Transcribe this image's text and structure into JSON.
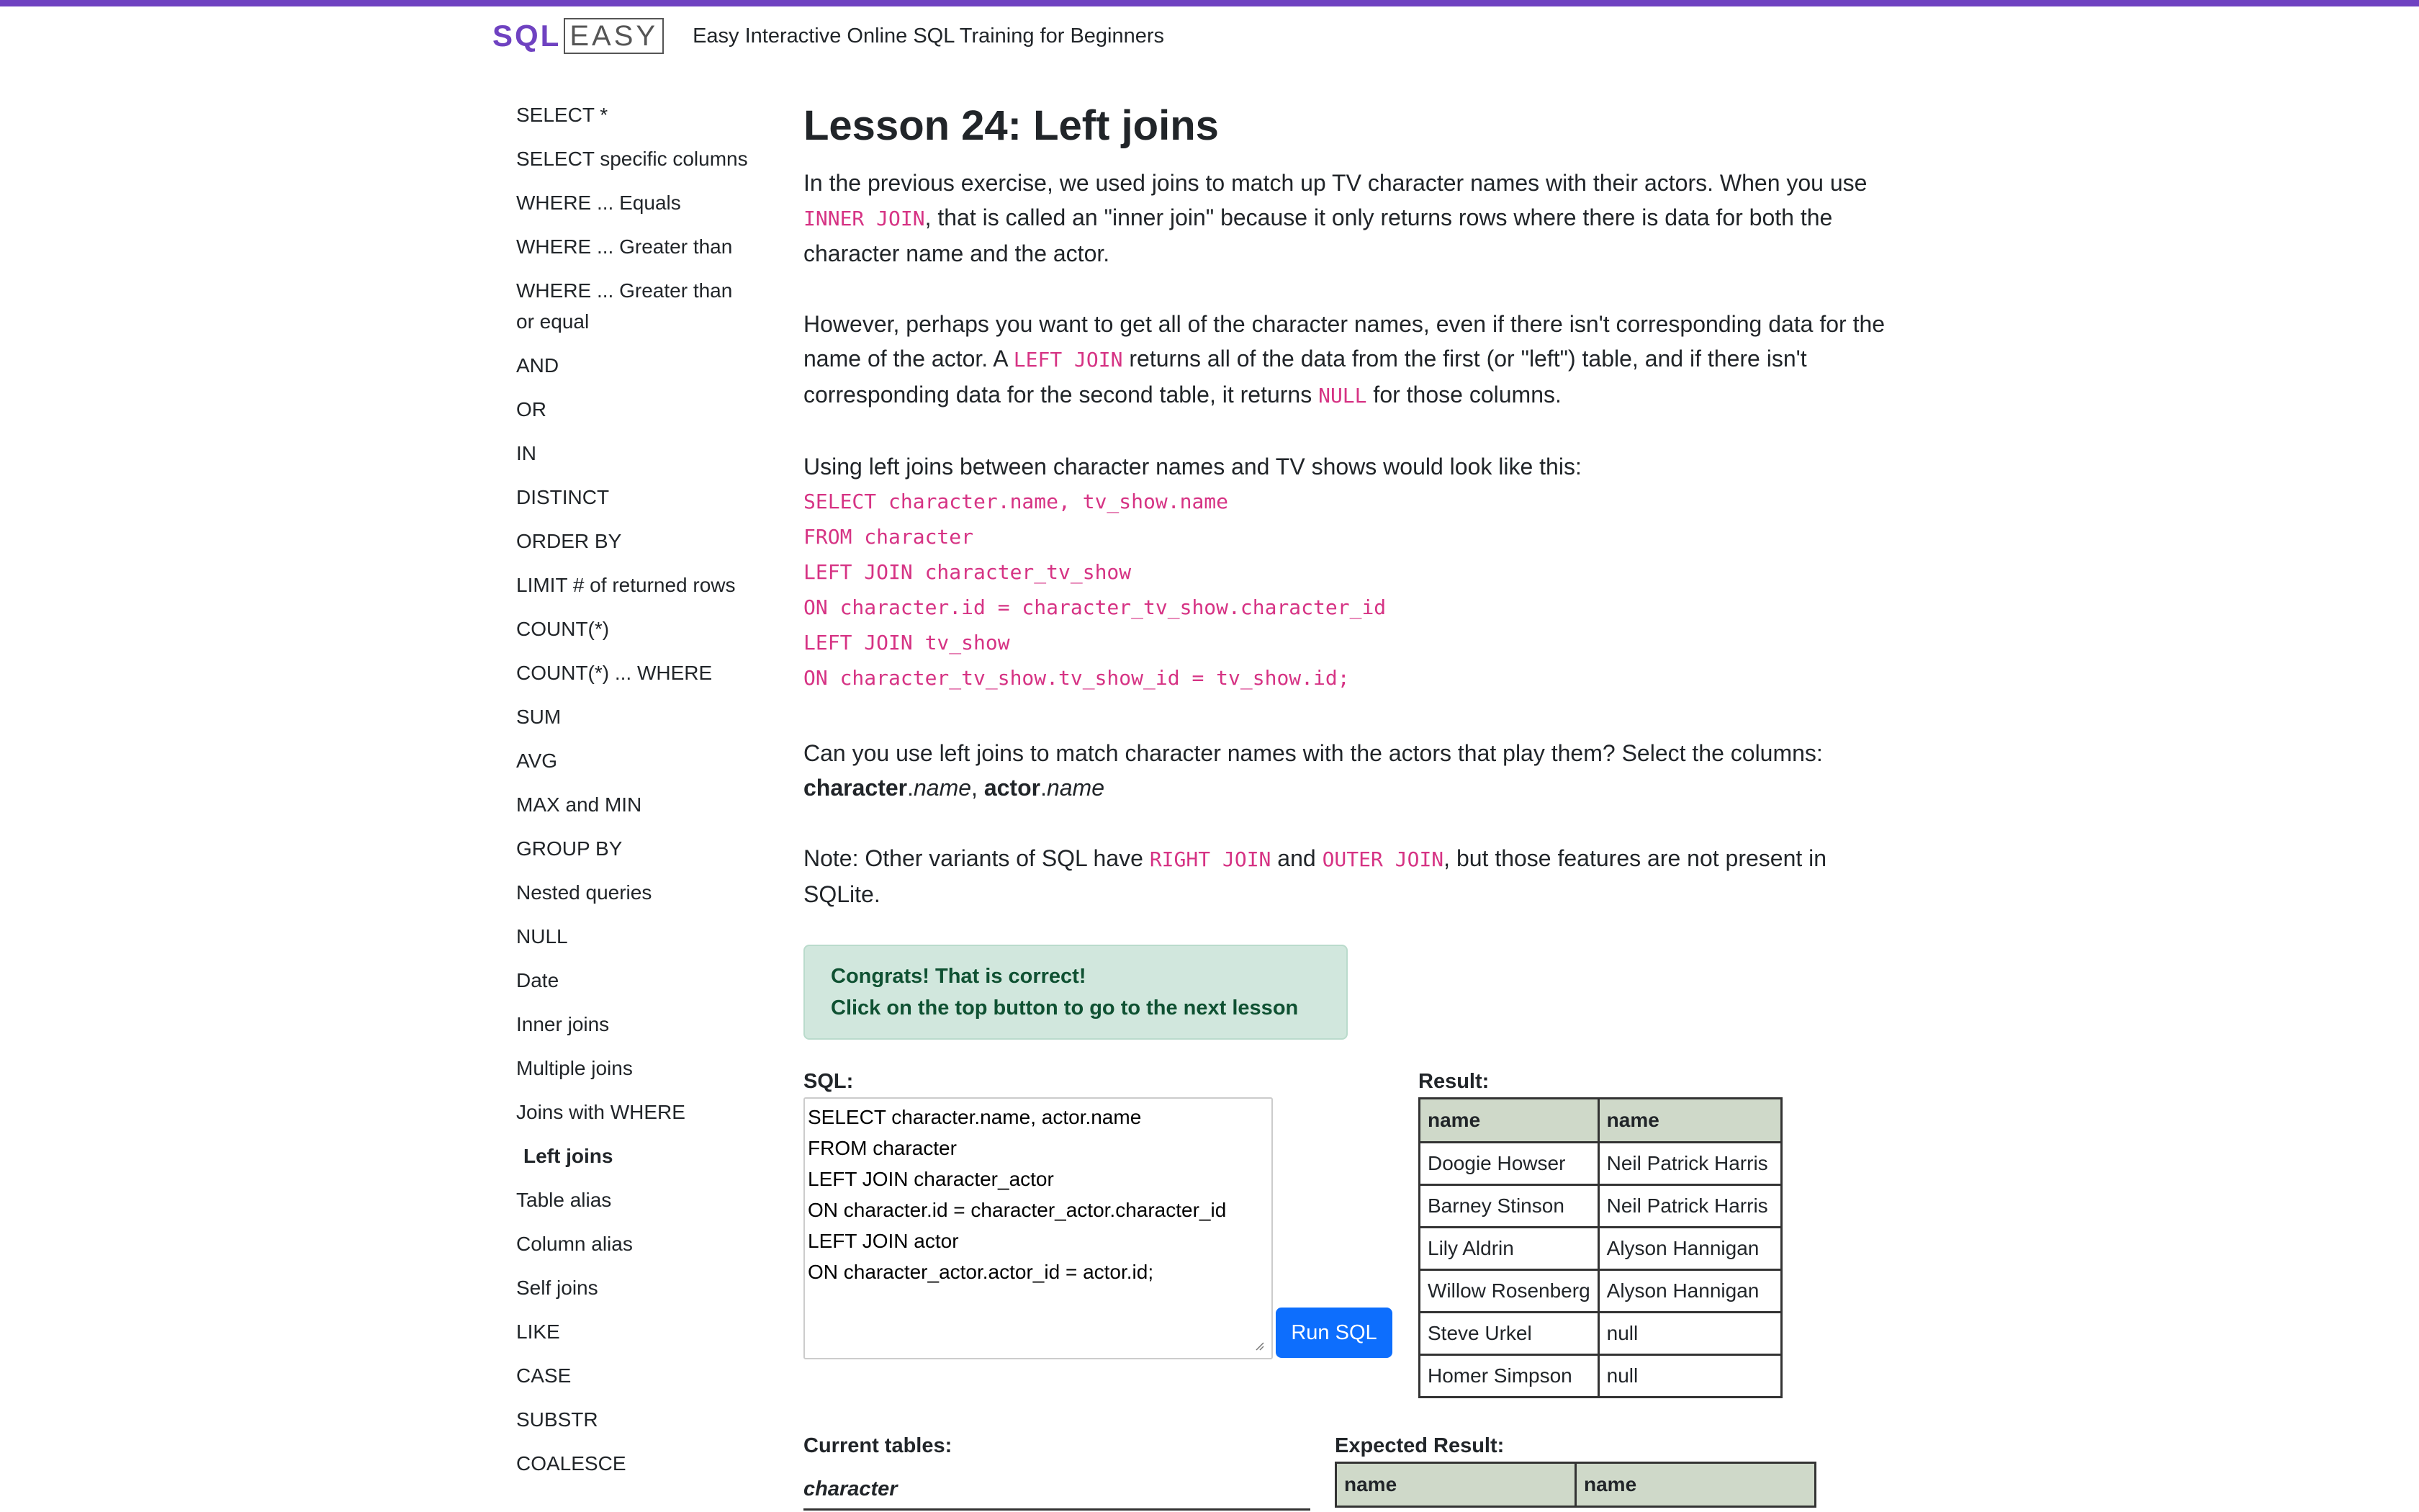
{
  "header": {
    "logo_sql": "SQL",
    "logo_easy": "EASY",
    "tagline": "Easy Interactive Online SQL Training for Beginners",
    "accent_color": "#6f42c1"
  },
  "sidebar": {
    "items": [
      {
        "label": "SELECT *"
      },
      {
        "label": "SELECT specific columns"
      },
      {
        "label": "WHERE ... Equals"
      },
      {
        "label": "WHERE ... Greater than"
      },
      {
        "label": "WHERE ... Greater than or equal"
      },
      {
        "label": "AND"
      },
      {
        "label": "OR"
      },
      {
        "label": "IN"
      },
      {
        "label": "DISTINCT"
      },
      {
        "label": "ORDER BY"
      },
      {
        "label": "LIMIT # of returned rows"
      },
      {
        "label": "COUNT(*)"
      },
      {
        "label": "COUNT(*) ... WHERE"
      },
      {
        "label": "SUM"
      },
      {
        "label": "AVG"
      },
      {
        "label": "MAX and MIN"
      },
      {
        "label": "GROUP BY"
      },
      {
        "label": "Nested queries"
      },
      {
        "label": "NULL"
      },
      {
        "label": "Date"
      },
      {
        "label": "Inner joins"
      },
      {
        "label": "Multiple joins"
      },
      {
        "label": "Joins with WHERE"
      },
      {
        "label": "Left joins",
        "active": true
      },
      {
        "label": "Table alias"
      },
      {
        "label": "Column alias"
      },
      {
        "label": "Self joins"
      },
      {
        "label": "LIKE"
      },
      {
        "label": "CASE"
      },
      {
        "label": "SUBSTR"
      },
      {
        "label": "COALESCE"
      }
    ]
  },
  "lesson": {
    "title": "Lesson 24: Left joins",
    "p1": {
      "a": "In the previous exercise, we used joins to match up TV character names with their actors. When you use ",
      "code": "INNER JOIN",
      "b": ", that is called an \"inner join\" because it only returns rows where there is data for both the character name and the actor."
    },
    "p2": {
      "a": "However, perhaps you want to get all of the character names, even if there isn't corresponding data for the name of the actor. A ",
      "code1": "LEFT JOIN",
      "b": " returns all of the data from the first (or \"left\") table, and if there isn't corresponding data for the second table, it returns ",
      "code2": "NULL",
      "c": " for those columns."
    },
    "p3": "Using left joins between character names and TV shows would look like this:",
    "code_lines": [
      "SELECT character.name, tv_show.name",
      "FROM character",
      "LEFT JOIN character_tv_show",
      "ON character.id = character_tv_show.character_id",
      "LEFT JOIN tv_show",
      "ON character_tv_show.tv_show_id = tv_show.id;"
    ],
    "p4": {
      "a": "Can you use left joins to match character names with the actors that play them? Select the columns: ",
      "t1": "character",
      "dot1": ".",
      "c1": "name",
      "sep": ", ",
      "t2": "actor",
      "dot2": ".",
      "c2": "name"
    },
    "p5": {
      "a": "Note: Other variants of SQL have ",
      "code1": "RIGHT JOIN",
      "b": " and ",
      "code2": "OUTER JOIN",
      "c": ", but those features are not present in SQLite."
    }
  },
  "alert": {
    "line1": "Congrats! That is correct!",
    "line2": "Click on the top button to go to the next lesson"
  },
  "sql": {
    "label": "SQL:",
    "value": "SELECT character.name, actor.name\nFROM character\nLEFT JOIN character_actor\nON character.id = character_actor.character_id\nLEFT JOIN actor\nON character_actor.actor_id = actor.id;",
    "run_label": "Run SQL"
  },
  "result": {
    "label": "Result:",
    "headers": [
      "name",
      "name"
    ],
    "rows": [
      [
        "Doogie Howser",
        "Neil Patrick Harris"
      ],
      [
        "Barney Stinson",
        "Neil Patrick Harris"
      ],
      [
        "Lily Aldrin",
        "Alyson Hannigan"
      ],
      [
        "Willow Rosenberg",
        "Alyson Hannigan"
      ],
      [
        "Steve Urkel",
        "null"
      ],
      [
        "Homer Simpson",
        "null"
      ]
    ]
  },
  "bottom": {
    "current_label": "Current tables:",
    "table_name": "character",
    "expected_label": "Expected Result:",
    "expected_headers": [
      "name",
      "name"
    ]
  }
}
